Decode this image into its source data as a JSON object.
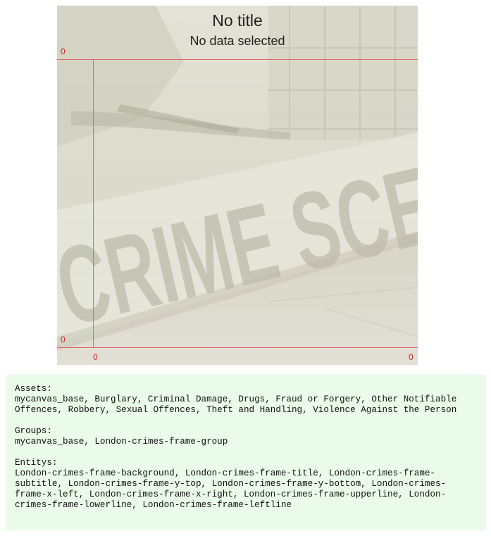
{
  "frame": {
    "title": "No title",
    "subtitle": "No data selected",
    "y_top_label": "0",
    "y_bottom_label": "0",
    "x_left_label": "0",
    "x_right_label": "0",
    "background_text": "CRIME SCENE-",
    "line_color": "#e06a6a",
    "label_color": "#cc2222"
  },
  "info": {
    "assets_heading": "Assets:",
    "assets_text": "mycanvas_base, Burglary, Criminal Damage, Drugs, Fraud or Forgery, Other Notifiable Offences, Robbery, Sexual Offences, Theft and Handling, Violence Against the Person",
    "groups_heading": "Groups:",
    "groups_text": "mycanvas_base, London-crimes-frame-group",
    "entitys_heading": "Entitys:",
    "entitys_text": "London-crimes-frame-background, London-crimes-frame-title, London-crimes-frame-subtitle, London-crimes-frame-y-top, London-crimes-frame-y-bottom, London-crimes-frame-x-left, London-crimes-frame-x-right, London-crimes-frame-upperline, London-crimes-frame-lowerline, London-crimes-frame-leftline",
    "background_color": "#eafbea"
  }
}
